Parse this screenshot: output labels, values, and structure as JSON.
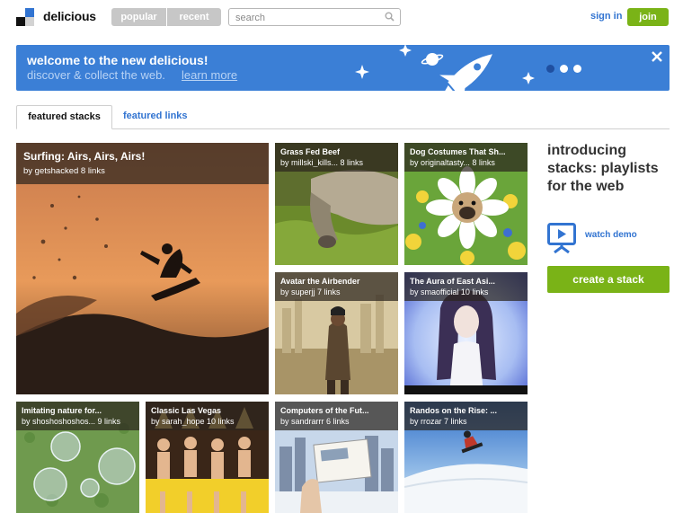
{
  "header": {
    "brand": "delicious",
    "nav": [
      "popular",
      "recent"
    ],
    "search_placeholder": "search",
    "sign_in": "sign in",
    "join": "join"
  },
  "banner": {
    "headline": "welcome to the new delicious!",
    "subtext": "discover & collect the web.",
    "link": "learn more",
    "close_icon": "close-icon",
    "carousel_active": 1,
    "carousel_count": 3
  },
  "tabs": {
    "featured_stacks": "featured stacks",
    "featured_links": "featured links"
  },
  "stacks": [
    {
      "title": "Surfing: Airs, Airs, Airs!",
      "meta": "by getshacked 8 links"
    },
    {
      "title": "Grass Fed Beef",
      "meta": "by millski_kills... 8 links"
    },
    {
      "title": "Dog Costumes That Sh...",
      "meta": "by originaltasty... 8 links"
    },
    {
      "title": "Avatar the Airbender",
      "meta": "by superjj 7 links"
    },
    {
      "title": "The Aura of East Asi...",
      "meta": "by smaofficial 10 links"
    },
    {
      "title": "Imitating nature for...",
      "meta": "by shoshoshoshos... 9 links"
    },
    {
      "title": "Classic Las Vegas",
      "meta": "by sarah_hope 10 links"
    },
    {
      "title": "Computers of the Fut...",
      "meta": "by sandrarrr 6 links"
    },
    {
      "title": "Randos on the Rise: ...",
      "meta": "by rrozar 7 links"
    }
  ],
  "sidebar": {
    "intro": "introducing stacks: playlists for the web",
    "watch_demo": "watch demo",
    "create": "create a stack"
  },
  "colors": {
    "accent_blue": "#3274d1",
    "banner_blue": "#3b7fd6",
    "green": "#7ab317"
  }
}
